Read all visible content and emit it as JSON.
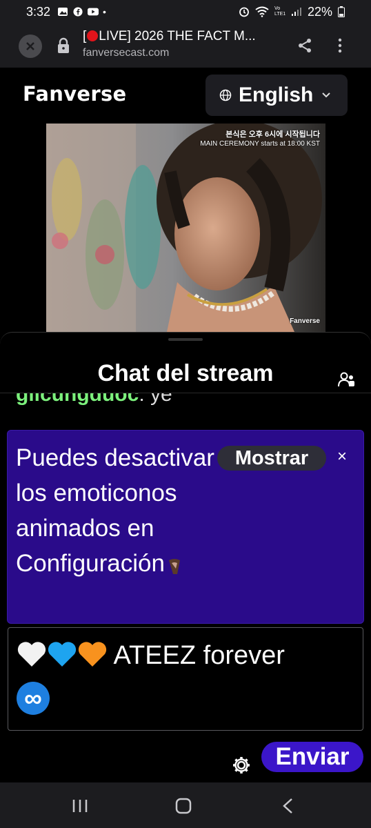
{
  "status_bar": {
    "time": "3:32",
    "battery": "22%",
    "network": "Vo LTE1"
  },
  "browser": {
    "title_prefix": "[",
    "title_rest": "LIVE] 2026 THE FACT M...",
    "url": "fanversecast.com",
    "icons": [
      "close-icon",
      "lock-icon",
      "share-icon",
      "more-vert-icon"
    ]
  },
  "header": {
    "brand": "Fanverse",
    "language": "English"
  },
  "video": {
    "overlay_ko": "본식은 오후 6시에 시작됩니다",
    "overlay_en": "MAIN CEREMONY starts at 18:00 KST",
    "watermark": "Fanverse"
  },
  "chat": {
    "title": "Chat del stream",
    "partial_user": "giicungduoc",
    "partial_text": ": ye",
    "notice_text": "Puedes desactivar los emoticonos animados en Configuración",
    "show_label": "Mostrar",
    "close_symbol": "×",
    "input_text": " ATEEZ forever",
    "input_emojis": [
      "white-heart",
      "blue-heart",
      "orange-heart",
      "infinity"
    ],
    "send_label": "Enviar"
  },
  "colors": {
    "notice_bg": "#2a0b8a",
    "send_bg": "#3b16c9",
    "username": "#7cf07c",
    "live_dot": "#e0141b"
  }
}
